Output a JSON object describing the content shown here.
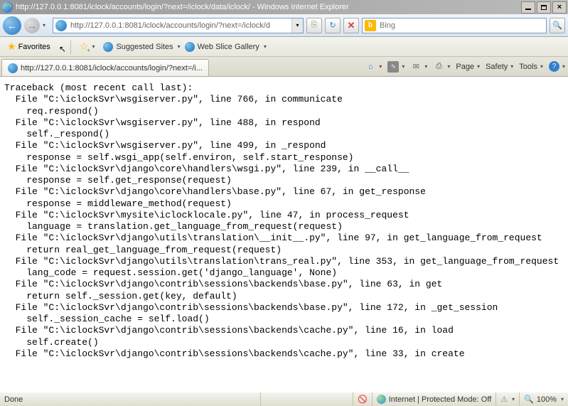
{
  "window": {
    "title": "http://127.0.0.1:8081/iclock/accounts/login/?next=/iclock/data/iclock/ - Windows Internet Explorer"
  },
  "address_bar": {
    "url": "http://127.0.0.1:8081/iclock/accounts/login/?next=/iclock/d"
  },
  "search": {
    "engine": "Bing",
    "value": ""
  },
  "favorites": {
    "label": "Favorites",
    "suggested": "Suggested Sites",
    "webslice": "Web Slice Gallery"
  },
  "tab": {
    "title": "http://127.0.0.1:8081/iclock/accounts/login/?next=/i..."
  },
  "toolbar": {
    "page": "Page",
    "safety": "Safety",
    "tools": "Tools"
  },
  "status": {
    "left": "Done",
    "zone": "Internet | Protected Mode: Off",
    "zoom": "100%"
  },
  "traceback": "Traceback (most recent call last):\n  File \"C:\\iclockSvr\\wsgiserver.py\", line 766, in communicate\n    req.respond()\n  File \"C:\\iclockSvr\\wsgiserver.py\", line 488, in respond\n    self._respond()\n  File \"C:\\iclockSvr\\wsgiserver.py\", line 499, in _respond\n    response = self.wsgi_app(self.environ, self.start_response)\n  File \"C:\\iclockSvr\\django\\core\\handlers\\wsgi.py\", line 239, in __call__\n    response = self.get_response(request)\n  File \"C:\\iclockSvr\\django\\core\\handlers\\base.py\", line 67, in get_response\n    response = middleware_method(request)\n  File \"C:\\iclockSvr\\mysite\\iclocklocale.py\", line 47, in process_request\n    language = translation.get_language_from_request(request)\n  File \"C:\\iclockSvr\\django\\utils\\translation\\__init__.py\", line 97, in get_language_from_request\n    return real_get_language_from_request(request)\n  File \"C:\\iclockSvr\\django\\utils\\translation\\trans_real.py\", line 353, in get_language_from_request\n    lang_code = request.session.get('django_language', None)\n  File \"C:\\iclockSvr\\django\\contrib\\sessions\\backends\\base.py\", line 63, in get\n    return self._session.get(key, default)\n  File \"C:\\iclockSvr\\django\\contrib\\sessions\\backends\\base.py\", line 172, in _get_session\n    self._session_cache = self.load()\n  File \"C:\\iclockSvr\\django\\contrib\\sessions\\backends\\cache.py\", line 16, in load\n    self.create()\n  File \"C:\\iclockSvr\\django\\contrib\\sessions\\backends\\cache.py\", line 33, in create"
}
